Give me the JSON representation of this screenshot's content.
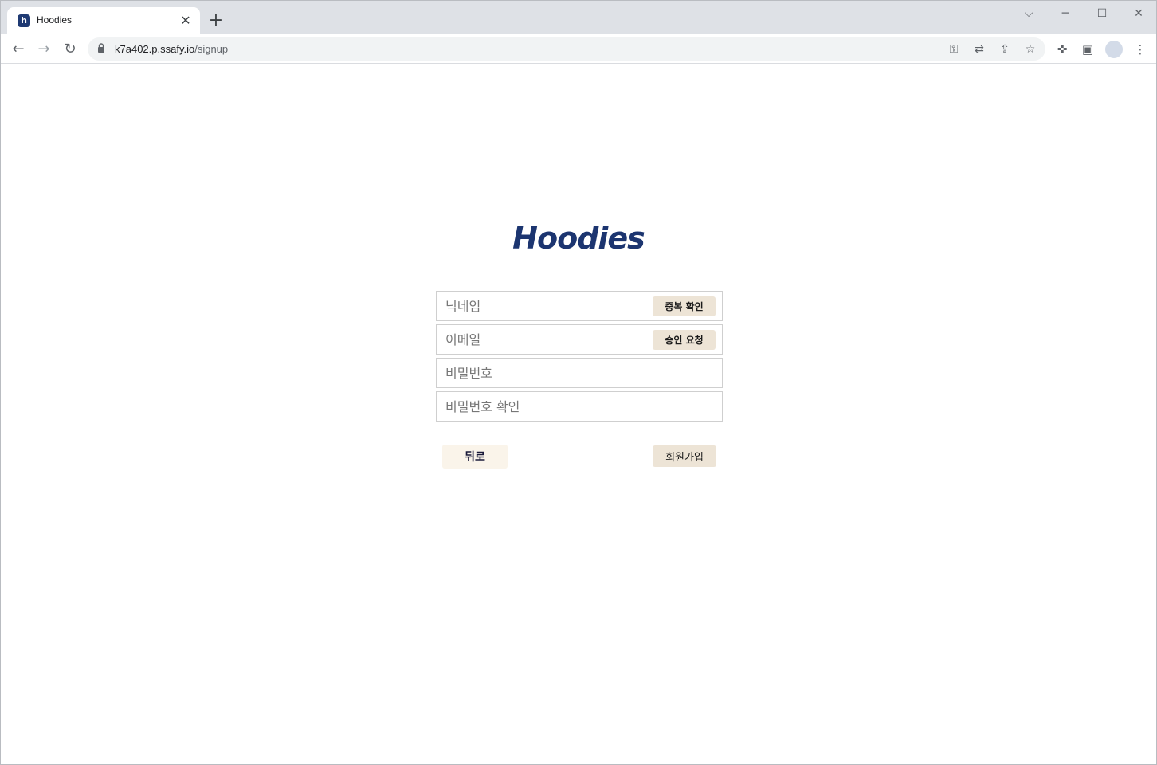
{
  "browser": {
    "tab_title": "Hoodies",
    "tab_favicon_letter": "h",
    "url_host": "k7a402.p.ssafy.io",
    "url_path": "/signup"
  },
  "signup": {
    "logo": "Hoodies",
    "nickname_placeholder": "닉네임",
    "nickname_check_label": "중복 확인",
    "email_placeholder": "이메일",
    "email_request_label": "승인 요청",
    "password_placeholder": "비밀번호",
    "password_confirm_placeholder": "비밀번호 확인",
    "back_label": "뒤로",
    "submit_label": "회원가입"
  },
  "colors": {
    "brand": "#1c3570",
    "button_bg": "#ede4d6",
    "back_button_bg": "#faf4ea"
  }
}
